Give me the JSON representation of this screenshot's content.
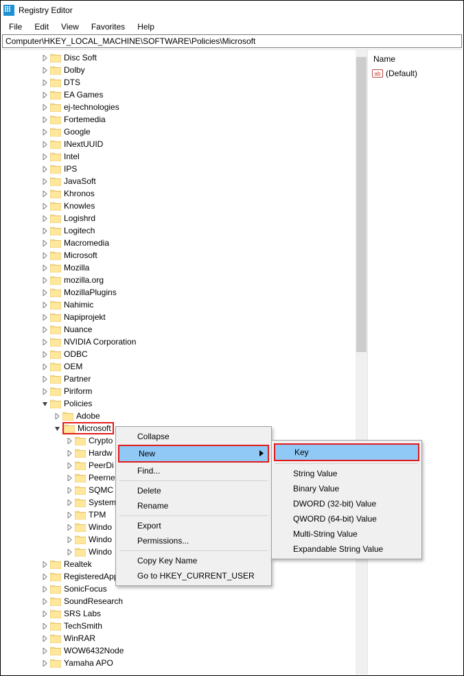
{
  "title": "Registry Editor",
  "menubar": [
    "File",
    "Edit",
    "View",
    "Favorites",
    "Help"
  ],
  "address": "Computer\\HKEY_LOCAL_MACHINE\\SOFTWARE\\Policies\\Microsoft",
  "tree": {
    "level1": [
      "Disc Soft",
      "Dolby",
      "DTS",
      "EA Games",
      "ej-technologies",
      "Fortemedia",
      "Google",
      "INextUUID",
      "Intel",
      "IPS",
      "JavaSoft",
      "Khronos",
      "Knowles",
      "Logishrd",
      "Logitech",
      "Macromedia",
      "Microsoft",
      "Mozilla",
      "mozilla.org",
      "MozillaPlugins",
      "Nahimic",
      "Napiprojekt",
      "Nuance",
      "NVIDIA Corporation",
      "ODBC",
      "OEM",
      "Partner",
      "Piriform"
    ],
    "policies_label": "Policies",
    "policies_children_pre": [
      "Adobe"
    ],
    "microsoft_label": "Microsoft",
    "microsoft_children": [
      "Crypto",
      "Hardw",
      "PeerDi",
      "Peerne",
      "SQMC",
      "System",
      "TPM",
      "Windo",
      "Windo",
      "Windo"
    ],
    "level1_after": [
      "Realtek",
      "RegisteredApplications",
      "SonicFocus",
      "SoundResearch",
      "SRS Labs",
      "TechSmith",
      "WinRAR",
      "WOW6432Node",
      "Yamaha APO"
    ]
  },
  "values_header": "Name",
  "values": [
    {
      "name": "(Default)"
    }
  ],
  "context_menu": {
    "items_before": [
      "Collapse"
    ],
    "new_label": "New",
    "items_mid": [
      "Find..."
    ],
    "items_after_sep1": [
      "Delete",
      "Rename"
    ],
    "items_after_sep2": [
      "Export",
      "Permissions..."
    ],
    "items_after_sep3": [
      "Copy Key Name",
      "Go to HKEY_CURRENT_USER"
    ]
  },
  "submenu": {
    "key_label": "Key",
    "rest": [
      "String Value",
      "Binary Value",
      "DWORD (32-bit) Value",
      "QWORD (64-bit) Value",
      "Multi-String Value",
      "Expandable String Value"
    ]
  }
}
